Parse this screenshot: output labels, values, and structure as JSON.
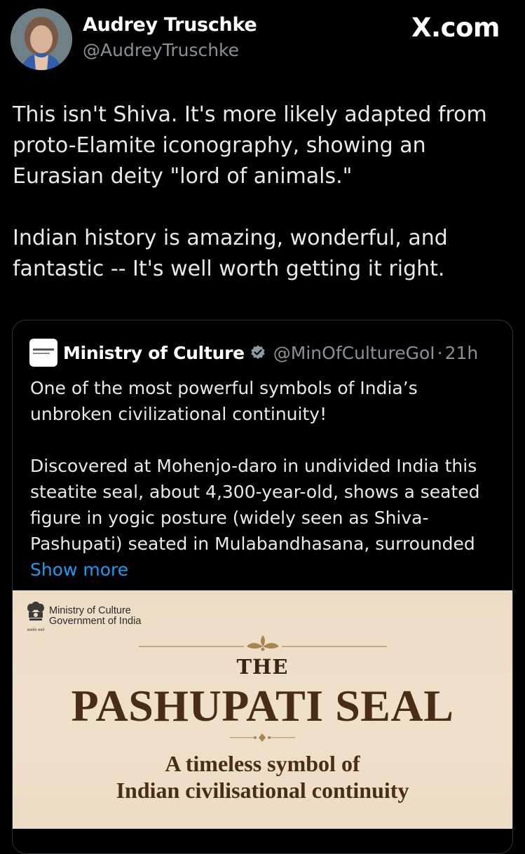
{
  "author": {
    "name": "Audrey Truschke",
    "handle": "@AudreyTruschke"
  },
  "site_label": "X.com",
  "tweet": {
    "paragraphs": [
      "This isn't Shiva. It's more likely adapted from proto-Elamite iconography, showing an Eurasian deity \"lord of animals.\"",
      "Indian history is amazing, wonderful, and fantastic -- It's well worth getting it right."
    ]
  },
  "quote": {
    "name": "Ministry of Culture",
    "handle": "@MinOfCultureGoI",
    "separator": "·",
    "time": "21h",
    "verified_icon": "verified-badge-icon",
    "paragraphs": [
      "One of the most powerful symbols of India’s unbroken civilizational continuity!",
      "Discovered at Mohenjo-daro in undivided India this steatite seal, about 4,300-year-old, shows a seated figure in yogic posture (widely seen as Shiva-Pashupati) seated in Mulabandhasana, surrounded"
    ],
    "show_more": "Show more",
    "media": {
      "org_line1": "Ministry of Culture",
      "org_line2": "Government of India",
      "emblem_caption": "सत्यमेव जयते",
      "the": "THE",
      "title": "PASHUPATI SEAL",
      "subtitle_line1": "A timeless symbol of",
      "subtitle_line2": "Indian civilisational continuity"
    }
  },
  "colors": {
    "background": "#000000",
    "text": "#e7e9ea",
    "muted": "#8b9096",
    "link": "#1d9bf0",
    "media_bg": "#eeddc6",
    "media_title": "#4a2d18"
  }
}
